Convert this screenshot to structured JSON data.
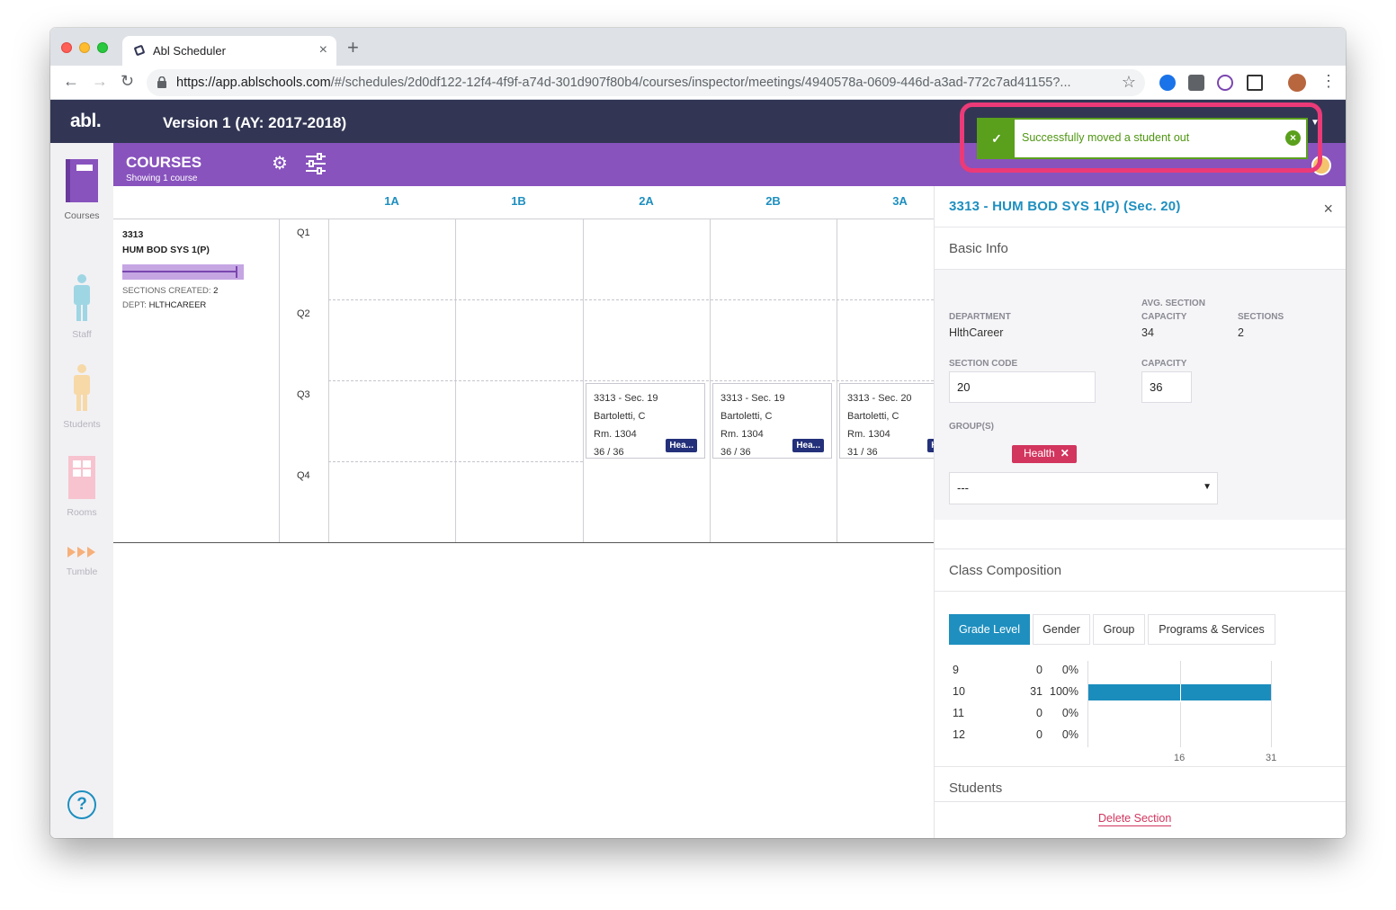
{
  "browser": {
    "tab_title": "Abl Scheduler",
    "tab_close": "×",
    "new_tab": "+",
    "url_host": "https://app.ablschools.com",
    "url_path": "/#/schedules/2d0df122-12f4-4f9f-a74d-301d907f80b4/courses/inspector/meetings/4940578a-0609-446d-a3ad-772c7ad41155?..."
  },
  "app": {
    "logo": "abl.",
    "version": "Version 1 (AY: 2017-2018)"
  },
  "toast": {
    "message": "Successfully moved a student out",
    "icon": "check-icon",
    "accent": "#5aa01c"
  },
  "rail": {
    "items": [
      {
        "label": "Courses",
        "icon": "courses-icon",
        "active": true
      },
      {
        "label": "Staff",
        "icon": "staff-icon",
        "active": false
      },
      {
        "label": "Students",
        "icon": "students-icon",
        "active": false
      },
      {
        "label": "Rooms",
        "icon": "rooms-icon",
        "active": false
      },
      {
        "label": "Tumble",
        "icon": "tumble-icon",
        "active": false
      }
    ],
    "help": "?"
  },
  "courses_bar": {
    "title": "COURSES",
    "subtitle": "Showing 1 course",
    "color": "#8853bd"
  },
  "grid": {
    "columns": [
      "1A",
      "1B",
      "2A",
      "2B",
      "3A"
    ],
    "quarters": [
      "Q1",
      "Q2",
      "Q3",
      "Q4"
    ],
    "course": {
      "code": "3313",
      "name": "HUM BOD SYS 1(P)",
      "sections_label": "SECTIONS CREATED:",
      "sections_value": "2",
      "dept_label": "DEPT:",
      "dept_value": "HLTHCAREER"
    },
    "sections": [
      {
        "title": "3313 - Sec. 19",
        "teacher": "Bartoletti, C",
        "room": "Rm. 1304",
        "enrollment": "36 / 36",
        "tag": "Hea..."
      },
      {
        "title": "3313 - Sec. 19",
        "teacher": "Bartoletti, C",
        "room": "Rm. 1304",
        "enrollment": "36 / 36",
        "tag": "Hea..."
      },
      {
        "title": "3313 - Sec. 20",
        "teacher": "Bartoletti, C",
        "room": "Rm. 1304",
        "enrollment": "31 / 36",
        "tag": "He"
      }
    ]
  },
  "inspector": {
    "title": "3313 - HUM BOD SYS 1(P) (Sec. 20)",
    "close": "×",
    "basic_info": "Basic Info",
    "department_label": "DEPARTMENT",
    "department_value": "HlthCareer",
    "avg_capacity_label_1": "AVG. SECTION",
    "avg_capacity_label_2": "CAPACITY",
    "avg_capacity_value": "34",
    "sections_label": "SECTIONS",
    "sections_value": "2",
    "section_code_label": "SECTION CODE",
    "section_code_value": "20",
    "capacity_label": "CAPACITY",
    "capacity_value": "36",
    "groups_label": "GROUP(S)",
    "group_chip": "Health",
    "group_chip_remove": "✕",
    "group_select_value": "---",
    "class_composition": "Class Composition",
    "tabs": [
      "Grade Level",
      "Gender",
      "Group",
      "Programs & Services"
    ],
    "active_tab": "Grade Level",
    "grade_levels": [
      {
        "grade": "9",
        "count": "0",
        "pct": "0%",
        "fraction": 0
      },
      {
        "grade": "10",
        "count": "31",
        "pct": "100%",
        "fraction": 1
      },
      {
        "grade": "11",
        "count": "0",
        "pct": "0%",
        "fraction": 0
      },
      {
        "grade": "12",
        "count": "0",
        "pct": "0%",
        "fraction": 0
      }
    ],
    "axis_ticks": [
      "16",
      "31"
    ],
    "students": "Students",
    "delete": "Delete Section"
  }
}
